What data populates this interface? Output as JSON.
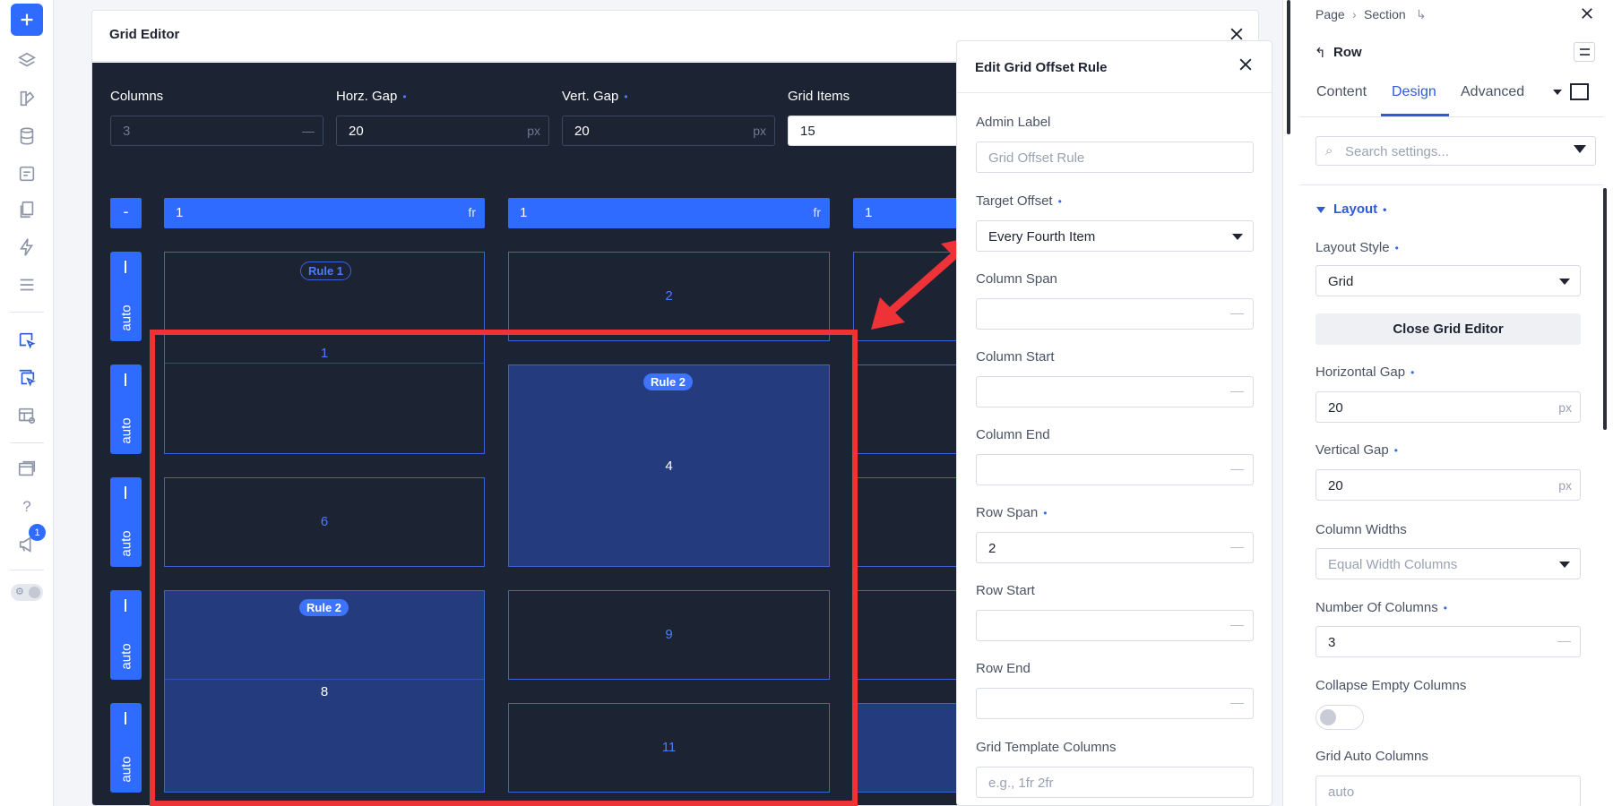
{
  "toolbar": {
    "items": [
      "add-icon",
      "layers-icon",
      "theme-icon",
      "database-icon",
      "form-icon",
      "pages-icon",
      "bolt-icon",
      "list-icon",
      "select-grid-icon",
      "select-grid-multi-icon",
      "layout-preview-icon",
      "windows-icon",
      "help-icon",
      "announcement-icon",
      "theme-toggle"
    ],
    "help_glyph": "?",
    "notification_count": "1",
    "toggle_glyph": "⚙"
  },
  "grid_editor": {
    "title": "Grid Editor",
    "fields": {
      "columns": {
        "label": "Columns",
        "value": "3",
        "unit": "—"
      },
      "horz_gap": {
        "label": "Horz. Gap",
        "value": "20",
        "unit": "px"
      },
      "vert_gap": {
        "label": "Vert. Gap",
        "value": "20",
        "unit": "px"
      },
      "grid_items": {
        "label": "Grid Items",
        "value": "15"
      }
    },
    "dot": "•",
    "remove_label": "-",
    "column_headers": [
      {
        "value": "1",
        "unit": "fr"
      },
      {
        "value": "1",
        "unit": "fr"
      },
      {
        "value": "1",
        "unit": ""
      }
    ],
    "row_headers": [
      "auto",
      "auto",
      "auto",
      "auto",
      "auto"
    ],
    "cells": {
      "c1": "1",
      "c2": "2",
      "c4": "4",
      "c6": "6",
      "c8": "8",
      "c9": "9",
      "c11": "11"
    },
    "pills": {
      "rule1": "Rule 1",
      "rule2a": "Rule 2",
      "rule2b": "Rule 2"
    }
  },
  "rule_panel": {
    "title": "Edit Grid Offset Rule",
    "fields": {
      "admin_label": {
        "label": "Admin Label",
        "placeholder": "Grid Offset Rule"
      },
      "target_offset": {
        "label": "Target Offset",
        "value": "Every Fourth Item"
      },
      "column_span": {
        "label": "Column Span"
      },
      "column_start": {
        "label": "Column Start"
      },
      "column_end": {
        "label": "Column End"
      },
      "row_span": {
        "label": "Row Span",
        "value": "2"
      },
      "row_start": {
        "label": "Row Start"
      },
      "row_end": {
        "label": "Row End"
      },
      "grid_template_columns": {
        "label": "Grid Template Columns",
        "placeholder": "e.g., 1fr 2fr"
      }
    }
  },
  "settings": {
    "breadcrumb": [
      "Page",
      "›",
      "Section",
      "↳"
    ],
    "back_glyph": "↰",
    "title": "Row",
    "tabs": [
      "Content",
      "Design",
      "Advanced"
    ],
    "search_glyph": "⌕",
    "search_placeholder": "Search settings...",
    "section": "Layout",
    "fields": {
      "layout_style": {
        "label": "Layout Style",
        "value": "Grid"
      },
      "close_grid_editor": "Close Grid Editor",
      "horizontal_gap": {
        "label": "Horizontal Gap",
        "value": "20",
        "unit": "px"
      },
      "vertical_gap": {
        "label": "Vertical Gap",
        "value": "20",
        "unit": "px"
      },
      "column_widths": {
        "label": "Column Widths",
        "placeholder": "Equal Width Columns"
      },
      "number_of_columns": {
        "label": "Number Of Columns",
        "value": "3"
      },
      "collapse_empty_columns": {
        "label": "Collapse Empty Columns",
        "value": false
      },
      "grid_auto_columns": {
        "label": "Grid Auto Columns",
        "placeholder": "auto"
      }
    }
  },
  "colors": {
    "accent": "#2f6bff",
    "dark_bg": "#1c2333",
    "highlight": "#ee3338"
  }
}
